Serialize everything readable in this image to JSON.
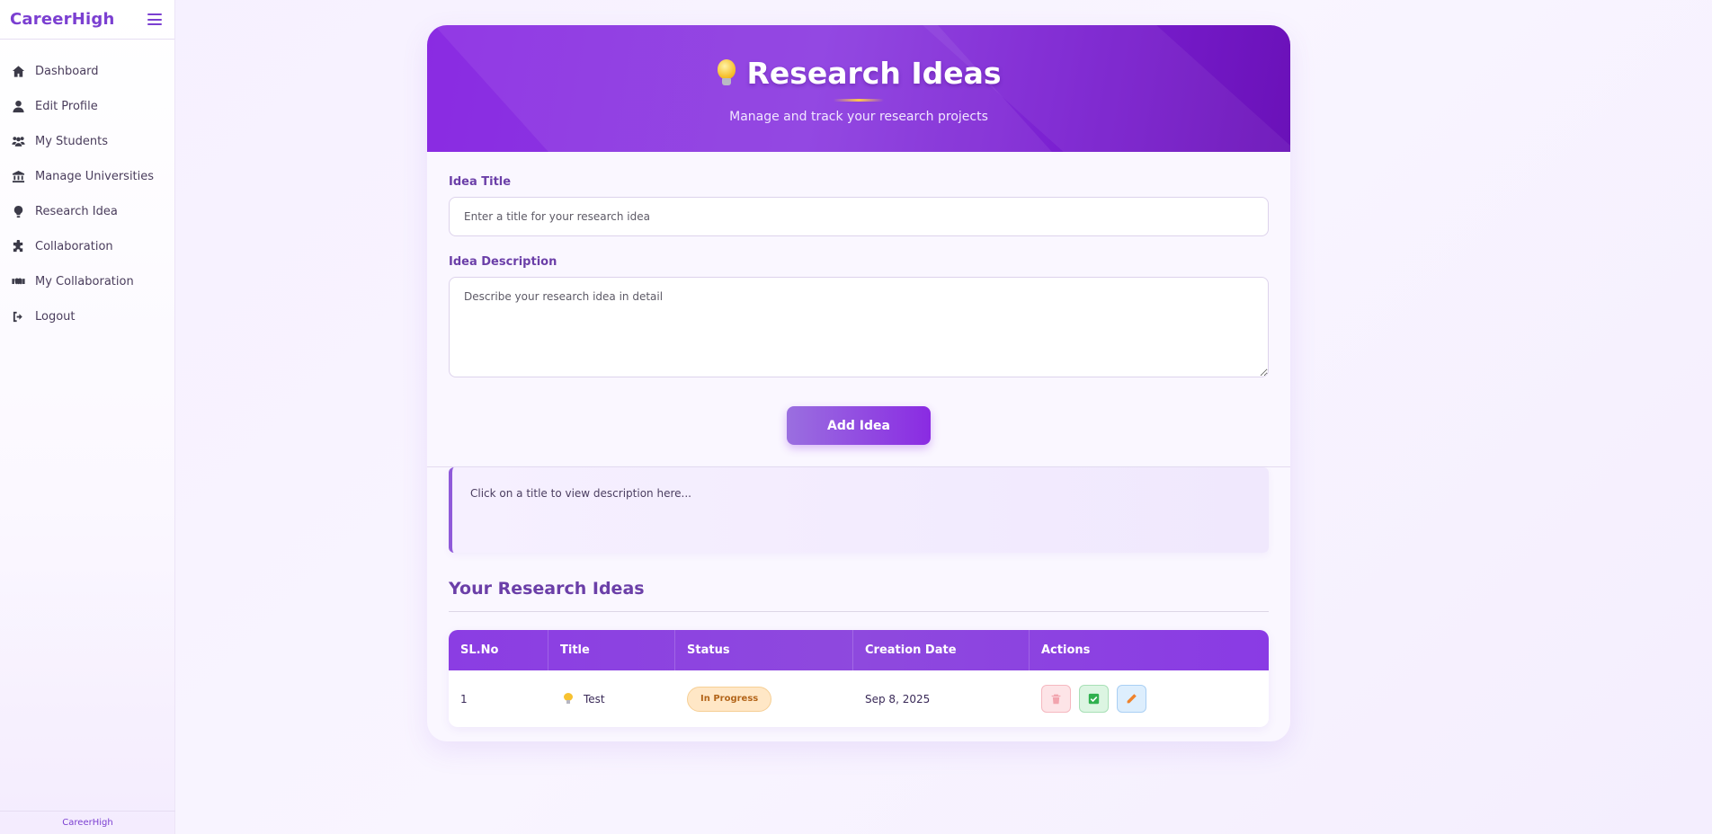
{
  "sidebar": {
    "brand": "CareerHigh",
    "items": [
      {
        "label": "Dashboard",
        "icon": "home-icon"
      },
      {
        "label": "Edit Profile",
        "icon": "user-icon"
      },
      {
        "label": "My Students",
        "icon": "users-icon"
      },
      {
        "label": "Manage Universities",
        "icon": "university-icon"
      },
      {
        "label": "Research Idea",
        "icon": "lightbulb-icon"
      },
      {
        "label": "Collaboration",
        "icon": "puzzle-icon"
      },
      {
        "label": "My Collaboration",
        "icon": "handshake-icon"
      },
      {
        "label": "Logout",
        "icon": "logout-icon"
      }
    ],
    "footer": "CareerHigh"
  },
  "header": {
    "title": "Research Ideas",
    "subtitle": "Manage and track your research projects"
  },
  "form": {
    "title_label": "Idea Title",
    "title_placeholder": "Enter a title for your research idea",
    "title_value": "",
    "description_label": "Idea Description",
    "description_placeholder": "Describe your research idea in detail",
    "description_value": "",
    "submit_label": "Add Idea"
  },
  "description_panel": {
    "text": "Click on a title to view description here..."
  },
  "ideas": {
    "section_title": "Your Research Ideas",
    "columns": [
      "SL.No",
      "Title",
      "Status",
      "Creation Date",
      "Actions"
    ],
    "rows": [
      {
        "sl_no": "1",
        "title": "Test",
        "status": "In Progress",
        "created": "Sep 8, 2025"
      }
    ]
  },
  "colors": {
    "accent": "#8a2be2",
    "status_in_progress": "#ffe7c6"
  }
}
